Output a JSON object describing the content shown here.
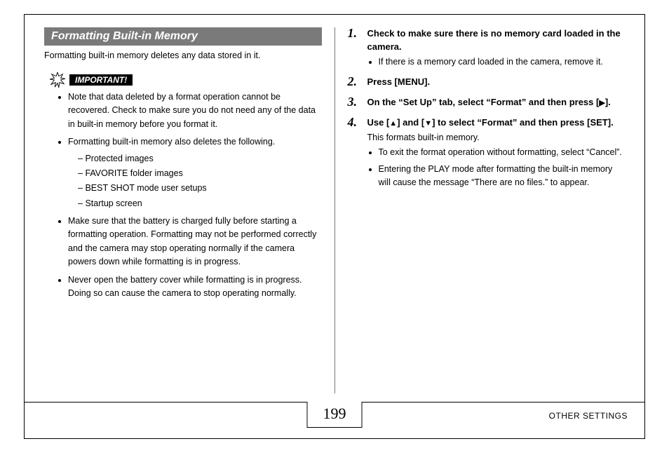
{
  "section_title": "Formatting Built-in Memory",
  "intro": "Formatting built-in memory deletes any data stored in it.",
  "important_label": "IMPORTANT!",
  "important_items": {
    "a": "Note that data deleted by a format operation cannot be recovered. Check to make sure you do not need any of the data in built-in memory before you format it.",
    "b": "Formatting built-in memory also deletes the following.",
    "b_sub": {
      "s1": "Protected images",
      "s2": "FAVORITE folder images",
      "s3": "BEST SHOT mode user setups",
      "s4": "Startup screen"
    },
    "c": "Make sure that the battery is charged fully before starting a formatting operation. Formatting may not be performed correctly and the camera may stop operating normally if the camera powers down while formatting is in progress.",
    "d": "Never open the battery cover while formatting is in progress. Doing so can cause the camera to stop operating normally."
  },
  "steps": {
    "s1": {
      "head": "Check to make sure there is no memory card loaded in the camera.",
      "bullets": {
        "b1": "If there is a memory card loaded in the camera, remove it."
      }
    },
    "s2": {
      "head": "Press [MENU]."
    },
    "s3": {
      "head_a": "On the “Set Up” tab, select “Format” and then press [",
      "head_b": "]."
    },
    "s4": {
      "head_a": "Use [",
      "head_b": "] and [",
      "head_c": "] to select “Format” and then press [SET].",
      "body": "This formats built-in memory.",
      "bullets": {
        "b1": "To exit the format operation without formatting, select “Cancel”.",
        "b2": "Entering the PLAY mode after formatting the built-in memory will cause the message “There are no files.” to appear."
      }
    }
  },
  "page_number": "199",
  "footer_label": "OTHER SETTINGS"
}
